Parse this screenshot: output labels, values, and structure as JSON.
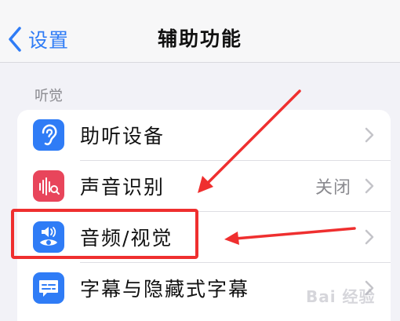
{
  "navbar": {
    "back_label": "设置",
    "title": "辅助功能"
  },
  "section": {
    "header": "听觉"
  },
  "rows": [
    {
      "label": "助听设备",
      "value": "",
      "icon": "ear-icon",
      "color": "#2f7cf6"
    },
    {
      "label": "声音识别",
      "value": "关闭",
      "icon": "sound-recognition-icon",
      "color": "#e8455b"
    },
    {
      "label": "音频/视觉",
      "value": "",
      "icon": "audio-visual-icon",
      "color": "#2f7cf6"
    },
    {
      "label": "字幕与隐藏式字幕",
      "value": "",
      "icon": "subtitles-icon",
      "color": "#2f7cf6"
    }
  ],
  "colors": {
    "accent": "#2f7cf6",
    "annotation_red": "#ef2f2f",
    "background": "#f2f2f7"
  },
  "watermark": {
    "text": "Bai 经验"
  }
}
